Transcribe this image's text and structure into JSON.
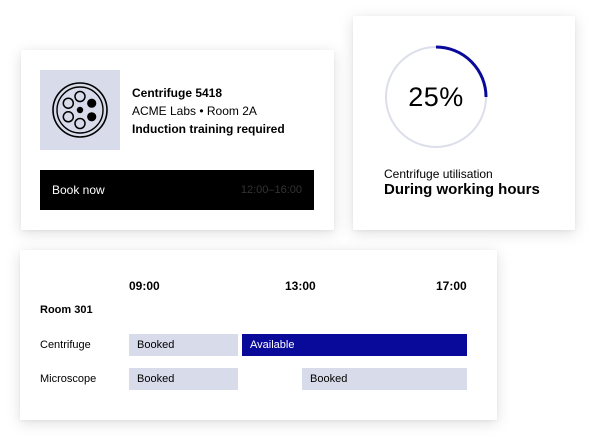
{
  "booking_card": {
    "equipment_name": "Centrifuge 5418",
    "location": "ACME Labs • Room 2A",
    "training_note": "Induction training required",
    "book_button_label": "Book now",
    "time_range": "12:00–16:00",
    "image_icon": "centrifuge-rotor-icon"
  },
  "utilisation_card": {
    "percent_label": "25%",
    "percent_value": 25,
    "label": "Centrifuge utilisation",
    "sublabel": "During working hours",
    "accent_color": "#0a0a9a",
    "track_color": "#dcdfea"
  },
  "schedule": {
    "times": [
      "09:00",
      "13:00",
      "17:00"
    ],
    "room": "Room 301",
    "rows": [
      {
        "name": "Centrifuge",
        "slots": [
          {
            "label": "Booked",
            "status": "booked"
          },
          {
            "label": "Available",
            "status": "available"
          }
        ]
      },
      {
        "name": "Microscope",
        "slots": [
          {
            "label": "Booked",
            "status": "booked"
          },
          {
            "label": "Booked",
            "status": "booked"
          }
        ]
      }
    ],
    "colors": {
      "booked": "#d8dcea",
      "available": "#0a0a9a"
    }
  }
}
